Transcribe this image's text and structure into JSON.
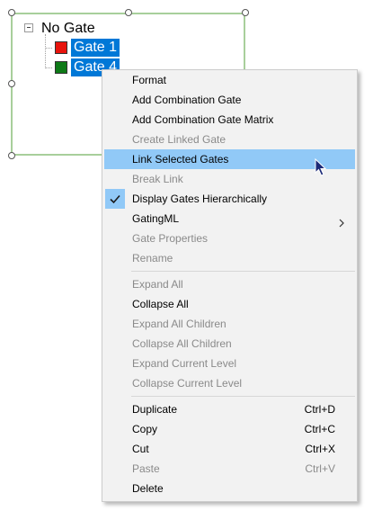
{
  "tree": {
    "root_label": "No Gate",
    "gates": [
      {
        "label": "Gate 1",
        "color": "#e8140c"
      },
      {
        "label": "Gate 4",
        "color": "#0e7a17"
      }
    ],
    "selection_color": "#0078d7",
    "frame_color": "#a8cf9b"
  },
  "menu": {
    "highlight_color": "#91c9f7",
    "items": [
      {
        "label": "Format",
        "enabled": true
      },
      {
        "label": "Add Combination Gate",
        "enabled": true
      },
      {
        "label": "Add Combination Gate Matrix",
        "enabled": true
      },
      {
        "label": "Create Linked Gate",
        "enabled": false
      },
      {
        "label": "Link Selected Gates",
        "enabled": true,
        "highlighted": true
      },
      {
        "label": "Break Link",
        "enabled": false
      },
      {
        "label": "Display Gates Hierarchically",
        "enabled": true,
        "checked": true
      },
      {
        "label": "GatingML",
        "enabled": true,
        "submenu": true
      },
      {
        "label": "Gate Properties",
        "enabled": false
      },
      {
        "label": "Rename",
        "enabled": false
      },
      {
        "label": "Expand All",
        "enabled": false
      },
      {
        "label": "Collapse All",
        "enabled": true
      },
      {
        "label": "Expand All Children",
        "enabled": false
      },
      {
        "label": "Collapse All Children",
        "enabled": false
      },
      {
        "label": "Expand Current Level",
        "enabled": false
      },
      {
        "label": "Collapse Current Level",
        "enabled": false
      },
      {
        "label": "Duplicate",
        "shortcut": "Ctrl+D",
        "enabled": true
      },
      {
        "label": "Copy",
        "shortcut": "Ctrl+C",
        "enabled": true
      },
      {
        "label": "Cut",
        "shortcut": "Ctrl+X",
        "enabled": true
      },
      {
        "label": "Paste",
        "shortcut": "Ctrl+V",
        "enabled": false
      },
      {
        "label": "Delete",
        "enabled": true
      }
    ],
    "icons": {
      "check": "check-icon",
      "submenu": "chevron-right-icon",
      "cursor": "mouse-pointer-icon"
    }
  }
}
